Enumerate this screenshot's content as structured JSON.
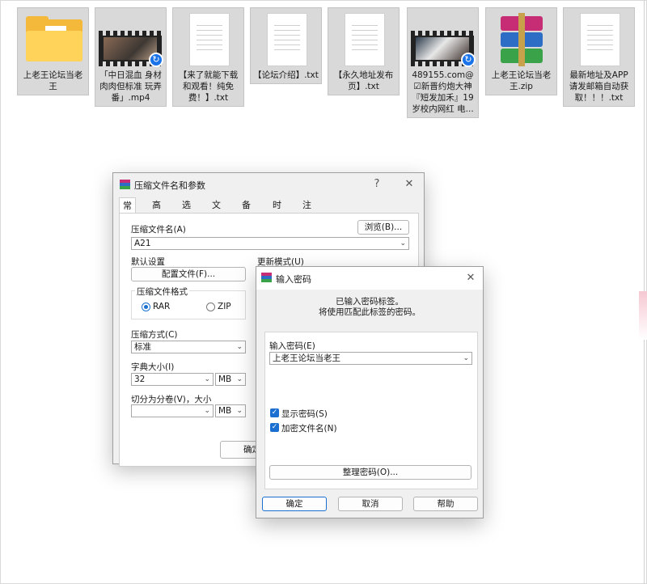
{
  "files": [
    {
      "name": "上老王论坛当老王",
      "icon": "folder-icon"
    },
    {
      "name": "「中日混血 身材肉肉但标准 玩弄番」.mp4",
      "icon": "video-icon"
    },
    {
      "name": "【来了就能下载和观看！纯免费！】.txt",
      "icon": "text-file-icon"
    },
    {
      "name": "【论坛介绍】.txt",
      "icon": "text-file-icon"
    },
    {
      "name": "【永久地址发布页】.txt",
      "icon": "text-file-icon"
    },
    {
      "name": "489155.com@☑新晋约炮大神『短发加禾』19岁校内网红 电...",
      "icon": "video-icon"
    },
    {
      "name": "上老王论坛当老王.zip",
      "icon": "rar-archive-icon"
    },
    {
      "name": "最新地址及APP请发邮箱自动获取！！！.txt",
      "icon": "text-file-icon"
    }
  ],
  "archive_dialog": {
    "title": "压缩文件名和参数",
    "help": "?",
    "close": "✕",
    "tabs": [
      "常规",
      "高级",
      "选项",
      "文件",
      "备份",
      "时间",
      "注释"
    ],
    "archive_name_label": "压缩文件名(A)",
    "browse_label": "浏览(B)...",
    "archive_name_value": "A21",
    "default_settings_label": "默认设置",
    "profiles_label": "配置文件(F)...",
    "update_mode_label": "更新模式(U)",
    "format_label": "压缩文件格式",
    "format_rar": "RAR",
    "format_zip": "ZIP",
    "method_label": "压缩方式(C)",
    "method_value": "标准",
    "dict_label": "字典大小(I)",
    "dict_value": "32",
    "dict_unit": "MB",
    "split_label": "切分为分卷(V)，大小",
    "split_value": "",
    "split_unit": "MB",
    "ok_partial": "确定"
  },
  "password_dialog": {
    "title": "输入密码",
    "close": "✕",
    "info_line1": "已输入密码标签。",
    "info_line2": "将使用匹配此标签的密码。",
    "password_label": "输入密码(E)",
    "password_value": "上老王论坛当老王",
    "show_password": "显示密码(S)",
    "encrypt_names": "加密文件名(N)",
    "organize_label": "整理密码(O)...",
    "ok": "确定",
    "cancel": "取消",
    "help": "帮助"
  }
}
